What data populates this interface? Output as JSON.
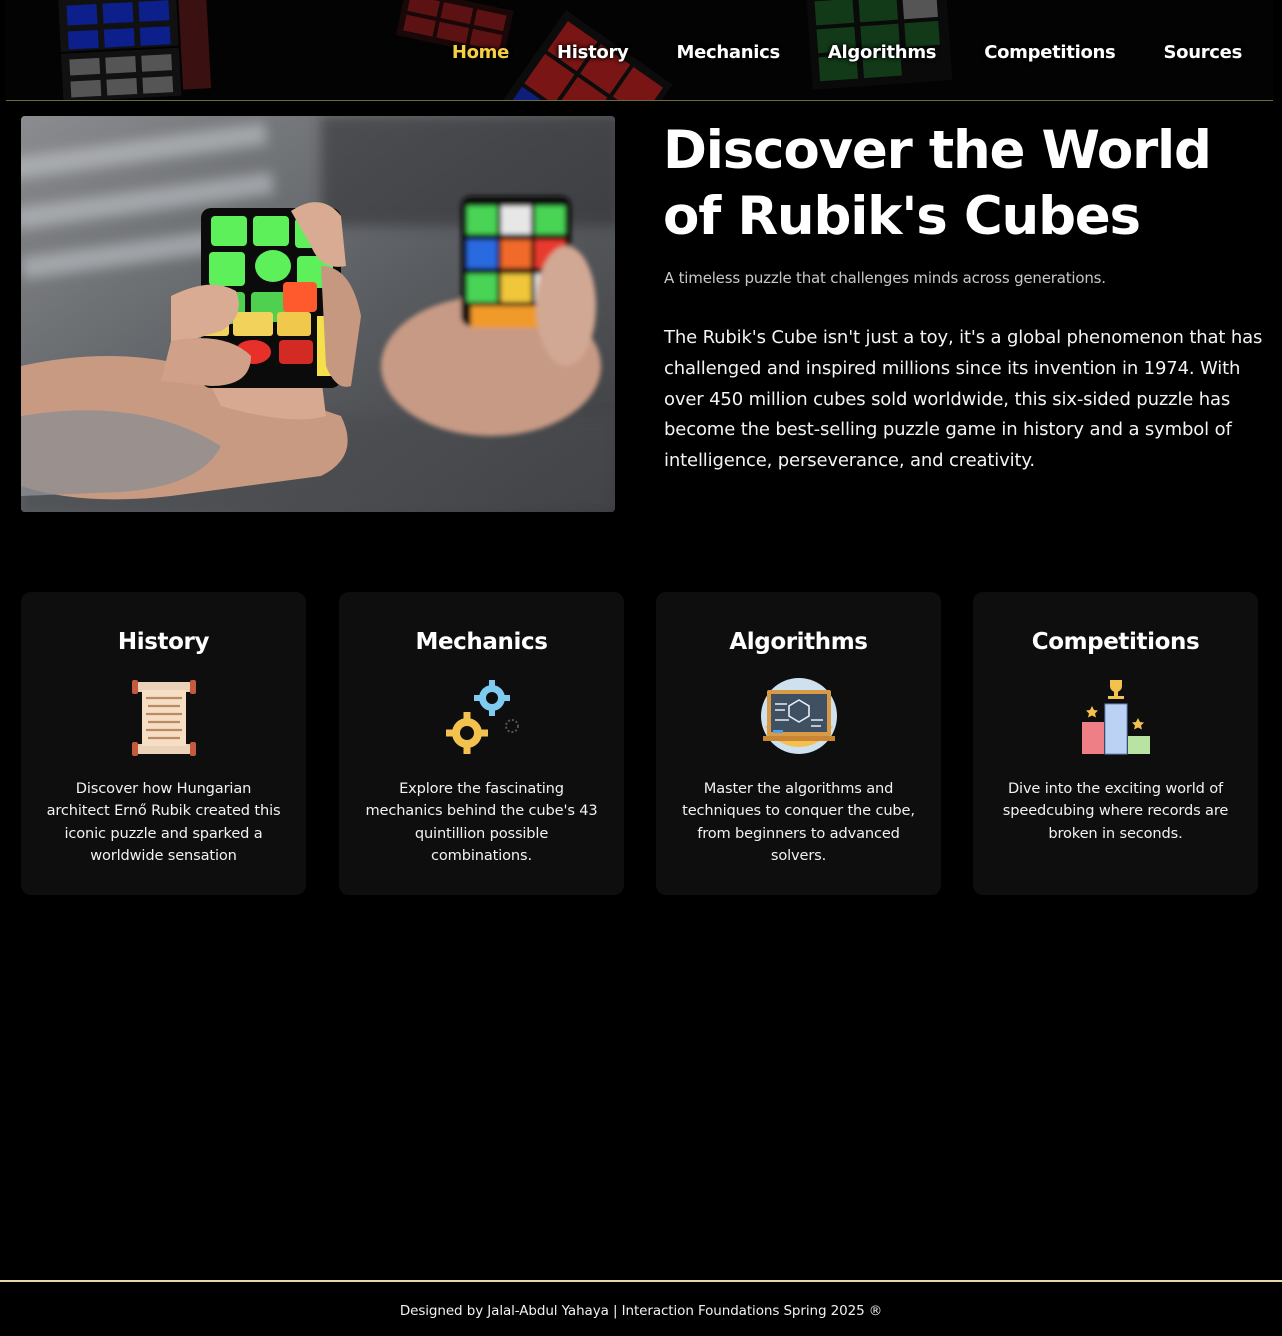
{
  "nav": {
    "items": [
      {
        "label": "Home",
        "active": true
      },
      {
        "label": "History",
        "active": false
      },
      {
        "label": "Mechanics",
        "active": false
      },
      {
        "label": "Algorithms",
        "active": false
      },
      {
        "label": "Competitions",
        "active": false
      },
      {
        "label": "Sources",
        "active": false
      }
    ]
  },
  "hero": {
    "image": "hands-solving-rubiks-cube-photo",
    "title": "Discover the World of Rubik's Cubes",
    "subtitle": "A timeless puzzle that challenges minds across generations.",
    "body": "The Rubik's Cube isn't just a toy, it's a global phenomenon that has challenged and inspired millions since its invention in 1974. With over 450 million cubes sold worldwide, this six-sided puzzle has become the best-selling puzzle game in history and a symbol of intelligence, perseverance, and creativity."
  },
  "cards": [
    {
      "title": "History",
      "icon": "scroll-icon",
      "text": "Discover how Hungarian architect Ernő Rubik created this iconic puzzle and sparked a worldwide sensation"
    },
    {
      "title": "Mechanics",
      "icon": "gears-icon",
      "text": "Explore the fascinating mechanics behind the cube's 43 quintillion possible combinations."
    },
    {
      "title": "Algorithms",
      "icon": "blackboard-icon",
      "text": "Master the algorithms and techniques to conquer the cube, from beginners to advanced solvers."
    },
    {
      "title": "Competitions",
      "icon": "podium-icon",
      "text": "Dive into the exciting world of speedcubing where records are broken in seconds."
    }
  ],
  "footer": {
    "text": "Designed by Jalal-Abdul Yahaya | Interaction Foundations Spring 2025 ®"
  },
  "colors": {
    "background": "#000000",
    "accent": "#f7cf45",
    "card": "#0e0e0e",
    "footer_border": "#e8d9a6"
  }
}
